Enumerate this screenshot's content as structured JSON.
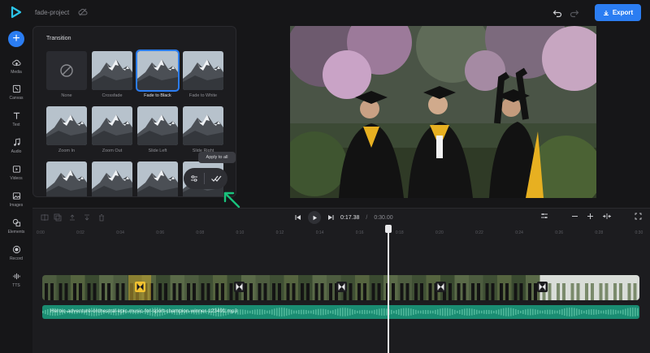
{
  "app": {
    "project_name": "fade-project",
    "export_label": "Export"
  },
  "sidebar": {
    "items": [
      {
        "label": "Media",
        "icon": "cloud-upload-icon"
      },
      {
        "label": "Canvas",
        "icon": "canvas-icon"
      },
      {
        "label": "Text",
        "icon": "text-icon"
      },
      {
        "label": "Audio",
        "icon": "music-note-icon"
      },
      {
        "label": "Videos",
        "icon": "video-icon"
      },
      {
        "label": "Images",
        "icon": "image-icon"
      },
      {
        "label": "Elements",
        "icon": "shapes-icon"
      },
      {
        "label": "Record",
        "icon": "record-icon"
      },
      {
        "label": "TTS",
        "icon": "tts-icon"
      }
    ]
  },
  "transition_panel": {
    "title": "Transition",
    "tiles": [
      {
        "label": "None",
        "selected": false
      },
      {
        "label": "Crossfade",
        "selected": false
      },
      {
        "label": "Fade to Black",
        "selected": true
      },
      {
        "label": "Fade to White",
        "selected": false
      },
      {
        "label": "Zoom In",
        "selected": false
      },
      {
        "label": "Zoom Out",
        "selected": false
      },
      {
        "label": "Slide Left",
        "selected": false
      },
      {
        "label": "Slide Right",
        "selected": false
      },
      {
        "label": "",
        "selected": false
      },
      {
        "label": "",
        "selected": false
      },
      {
        "label": "",
        "selected": false
      },
      {
        "label": "",
        "selected": false
      }
    ],
    "apply_to_all_tooltip": "Apply to all"
  },
  "playback": {
    "current_time": "0:17.38",
    "separator": "/",
    "total_time": "0:30.00"
  },
  "ruler": {
    "ticks": [
      "0:00",
      "0:02",
      "0:04",
      "0:06",
      "0:08",
      "0:10",
      "0:12",
      "0:14",
      "0:16",
      "0:18",
      "0:20",
      "0:22",
      "0:24",
      "0:26",
      "0:28",
      "0:30"
    ]
  },
  "tracks": {
    "audio_filename": "Heroic-adventure-orchestral-epic-music-for-sport-champion-winner-123491.mp3"
  },
  "colors": {
    "accent": "#2b7df2",
    "audio_track": "#1a8c72",
    "selected_transition": "#f2c230",
    "hint_arrow": "#19c37d"
  }
}
